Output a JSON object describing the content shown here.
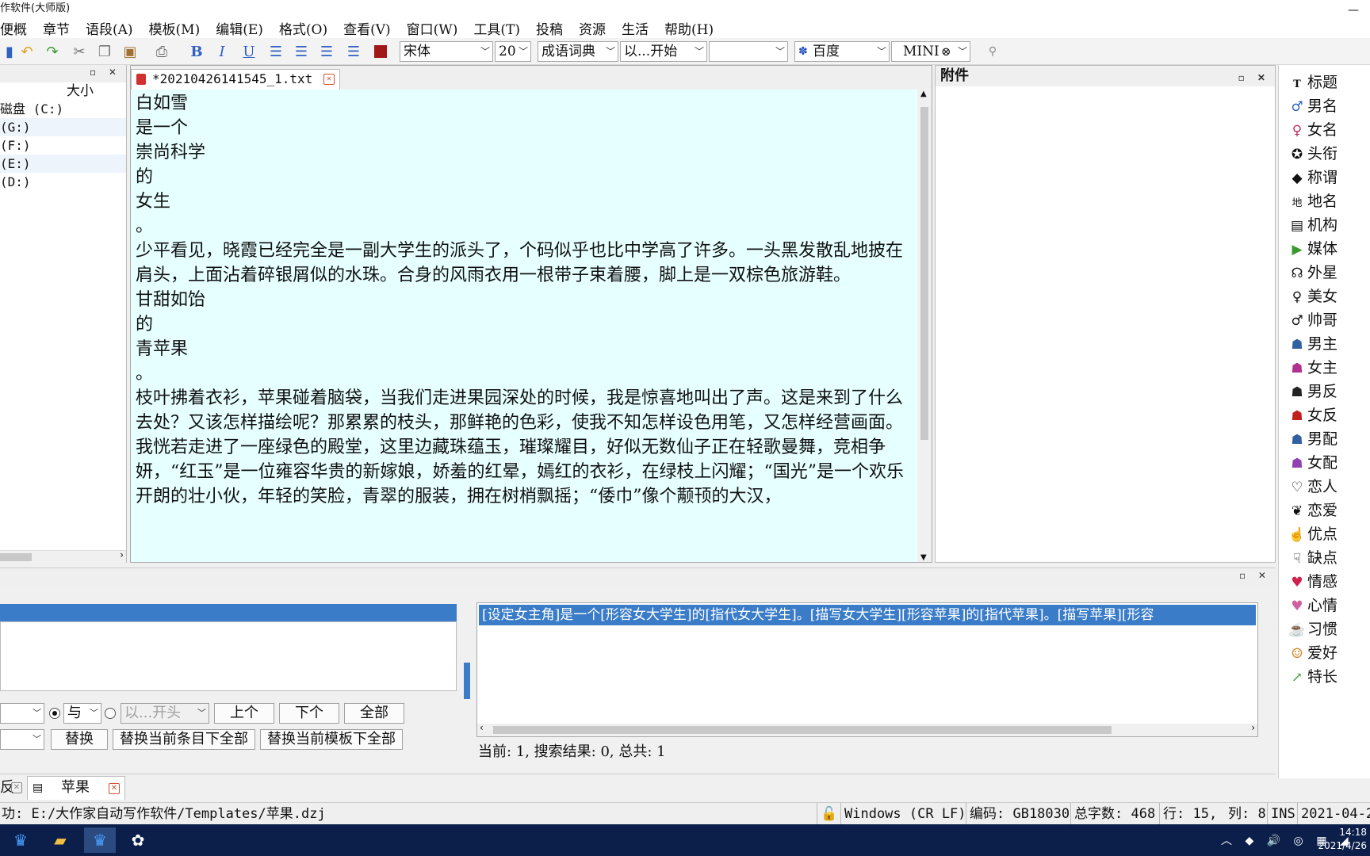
{
  "window": {
    "title": "作软件(大师版)",
    "minimize": "—"
  },
  "menu": [
    "便概",
    "章节",
    "语段(A)",
    "模板(M)",
    "编辑(E)",
    "格式(O)",
    "查看(V)",
    "窗口(W)",
    "工具(T)",
    "投稿",
    "资源",
    "生活",
    "帮助(H)"
  ],
  "toolbar": {
    "font": "宋体",
    "size": "20",
    "dict": "成语词典",
    "match": "以...开始",
    "search_value": "",
    "engine": "百度",
    "mini": "MINI",
    "bold": "B",
    "italic": "I",
    "underline": "U"
  },
  "file_panel": {
    "size_header": "大小",
    "drives": [
      "磁盘 (C:)",
      "(G:)",
      "(F:)",
      "(E:)",
      "(D:)"
    ]
  },
  "editor": {
    "tab_title": "*20210426141545_1.txt",
    "paragraphs": [
      "白如雪",
      "是一个",
      "崇尚科学",
      "的",
      "女生",
      "。",
      "少平看见，晓霞已经完全是一副大学生的派头了，个码似乎也比中学高了许多。一头黑发散乱地披在肩头，上面沾着碎银屑似的水珠。合身的风雨衣用一根带子束着腰，脚上是一双棕色旅游鞋。",
      "甘甜如饴",
      "的",
      "青苹果",
      "。",
      "枝叶拂着衣衫，苹果碰着脑袋，当我们走进果园深处的时候，我是惊喜地叫出了声。这是来到了什么去处？又该怎样描绘呢？那累累的枝头，那鲜艳的色彩，使我不知怎样设色用笔，又怎样经营画面。我恍若走进了一座绿色的殿堂，这里边藏珠蕴玉，璀璨耀目，好似无数仙子正在轻歌曼舞，竞相争妍，“红玉”是一位雍容华贵的新嫁娘，娇羞的红晕，嫣红的衣衫，在绿枝上闪耀；“国光”是一个欢乐开朗的壮小伙，年轻的笑脸，青翠的服装，拥在树梢飘摇；“倭巾”像个颟顸的大汉，"
    ]
  },
  "attach_panel": {
    "title": "附件"
  },
  "tags": [
    {
      "icon": "title-icon",
      "glyph": "T",
      "label": "标题"
    },
    {
      "icon": "male-name-icon",
      "glyph": "♂",
      "label": "男名"
    },
    {
      "icon": "female-name-icon",
      "glyph": "♀",
      "label": "女名"
    },
    {
      "icon": "medal-icon",
      "glyph": "✪",
      "label": "头衔"
    },
    {
      "icon": "tag-icon",
      "glyph": "◆",
      "label": "称谓"
    },
    {
      "icon": "place-icon",
      "glyph": "地",
      "label": "地名"
    },
    {
      "icon": "org-icon",
      "glyph": "▤",
      "label": "机构"
    },
    {
      "icon": "media-icon",
      "glyph": "▶",
      "label": "媒体"
    },
    {
      "icon": "alien-icon",
      "glyph": "☊",
      "label": "外星"
    },
    {
      "icon": "venus-icon",
      "glyph": "♀",
      "label": "美女"
    },
    {
      "icon": "mars-icon",
      "glyph": "♂",
      "label": "帅哥"
    },
    {
      "icon": "male-lead-icon",
      "glyph": "☗",
      "label": "男主"
    },
    {
      "icon": "female-lead-icon",
      "glyph": "☗",
      "label": "女主"
    },
    {
      "icon": "male-villain-icon",
      "glyph": "☗",
      "label": "男反"
    },
    {
      "icon": "female-villain-icon",
      "glyph": "☗",
      "label": "女反"
    },
    {
      "icon": "male-support-icon",
      "glyph": "☗",
      "label": "男配"
    },
    {
      "icon": "female-support-icon",
      "glyph": "☗",
      "label": "女配"
    },
    {
      "icon": "heart-icon",
      "glyph": "♡",
      "label": "恋人"
    },
    {
      "icon": "love-icon",
      "glyph": "❦",
      "label": "恋爱"
    },
    {
      "icon": "thumbs-up-icon",
      "glyph": "👍",
      "label": "优点"
    },
    {
      "icon": "thumbs-down-icon",
      "glyph": "👎",
      "label": "缺点"
    },
    {
      "icon": "person-heart-icon",
      "glyph": "♥",
      "label": "情感"
    },
    {
      "icon": "heart-pink-icon",
      "glyph": "♥",
      "label": "心情"
    },
    {
      "icon": "cup-icon",
      "glyph": "☕",
      "label": "习惯"
    },
    {
      "icon": "face-icon",
      "glyph": "☺",
      "label": "爱好"
    },
    {
      "icon": "chart-icon",
      "glyph": "↗",
      "label": "特长"
    }
  ],
  "search": {
    "radio_option": "与",
    "match_option": "以...开头",
    "prev": "上个",
    "next": "下个",
    "all": "全部",
    "replace": "替换",
    "replace_entry_all": "替换当前条目下全部",
    "replace_template_all": "替换当前模板下全部",
    "result_line": "[设定女主角]是一个[形容女大学生]的[指代女大学生]。[描写女大学生][形容苹果]的[指代苹果]。[描写苹果][形容",
    "counts": "当前: 1, 搜索结果: 0, 总共: 1"
  },
  "doc_tabs": {
    "partial_label": "反",
    "active_label": "苹果"
  },
  "status": {
    "path": "功: E:/大作家自动写作软件/Templates/苹果.dzj",
    "line_ending": "Windows (CR LF)",
    "encoding": "编码: GB18030",
    "chars": "总字数: 468",
    "row": "行: 15,",
    "col": "列: 8",
    "mode": "INS",
    "date": "2021-04-2"
  },
  "taskbar": {
    "time": "14:18",
    "date": "2021/4/26"
  },
  "colors": {
    "editor_bg": "#e6ffff",
    "selection": "#3a7cc8",
    "taskbar": "#0b1f4a"
  }
}
